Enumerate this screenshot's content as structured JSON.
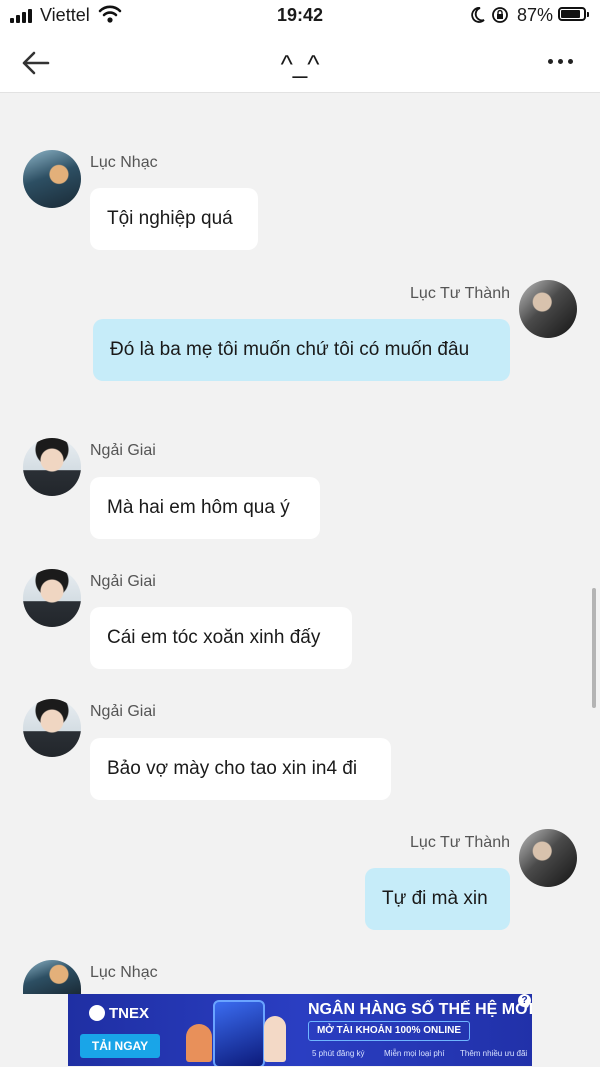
{
  "status_bar": {
    "carrier": "Viettel",
    "time": "19:42",
    "battery_percent": "87%",
    "battery_level": 0.87,
    "icons": [
      "signal-icon",
      "wifi-icon",
      "moon-icon",
      "orientation-lock-icon",
      "battery-icon"
    ]
  },
  "header": {
    "title": "^_^",
    "back_icon": "arrow-left-icon",
    "more_icon": "more-icon"
  },
  "messages": [
    {
      "sender": "Lục Nhạc",
      "text": "Tội nghiệp quá",
      "side": "left"
    },
    {
      "sender": "Lục Tư Thành",
      "text": "Đó là ba mẹ tôi muốn chứ tôi có muốn đâu",
      "side": "right"
    },
    {
      "sender": "Ngải Giai",
      "text": "Mà hai em hôm qua ý",
      "side": "left"
    },
    {
      "sender": "Ngải Giai",
      "text": "Cái em tóc xoăn xinh đấy",
      "side": "left"
    },
    {
      "sender": "Ngải Giai",
      "text": "Bảo vợ mày cho tao xin in4 đi",
      "side": "left"
    },
    {
      "sender": "Lục Tư Thành",
      "text": "Tự đi mà xin",
      "side": "right"
    },
    {
      "sender": "Lục Nhạc",
      "text": "",
      "side": "left"
    }
  ],
  "ad": {
    "brand": "TNEX",
    "cta": "TẢI NGAY",
    "headline": "NGÂN HÀNG SỐ THẾ HỆ MỚI",
    "subline": "MỞ TÀI KHOẢN 100% ONLINE",
    "features": [
      "5 phút đăng ký",
      "Miễn mọi loại phí",
      "Thêm nhiều ưu đãi"
    ],
    "help_label": "?"
  },
  "colors": {
    "incoming_bubble": "#ffffff",
    "outgoing_bubble": "#c6ecf9",
    "background": "#f2f2f2",
    "ad_background": "#2131a9"
  }
}
